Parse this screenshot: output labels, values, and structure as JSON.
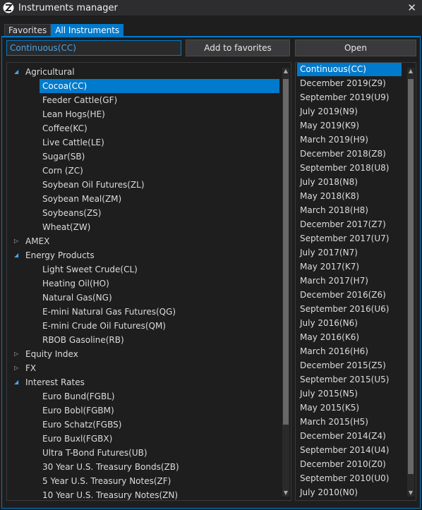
{
  "window": {
    "title": "Instruments manager",
    "close_label": "✕"
  },
  "tabs": [
    {
      "label": "Favorites",
      "active": false
    },
    {
      "label": "All Instruments",
      "active": true
    }
  ],
  "search": {
    "value": "Continuous(CC)"
  },
  "buttons": {
    "add_favorites": "Add to favorites",
    "open": "Open"
  },
  "tree": [
    {
      "type": "group",
      "label": "Agricultural",
      "expanded": true
    },
    {
      "type": "item",
      "label": "Cocoa(CC)",
      "selected": true
    },
    {
      "type": "item",
      "label": "Feeder Cattle(GF)"
    },
    {
      "type": "item",
      "label": "Lean Hogs(HE)"
    },
    {
      "type": "item",
      "label": "Coffee(KC)"
    },
    {
      "type": "item",
      "label": "Live Cattle(LE)"
    },
    {
      "type": "item",
      "label": "Sugar(SB)"
    },
    {
      "type": "item",
      "label": "Corn (ZC)"
    },
    {
      "type": "item",
      "label": "Soybean Oil Futures(ZL)"
    },
    {
      "type": "item",
      "label": "Soybean Meal(ZM)"
    },
    {
      "type": "item",
      "label": "Soybeans(ZS)"
    },
    {
      "type": "item",
      "label": "Wheat(ZW)"
    },
    {
      "type": "group",
      "label": "AMEX",
      "expanded": false
    },
    {
      "type": "group",
      "label": "Energy Products",
      "expanded": true
    },
    {
      "type": "item",
      "label": "Light Sweet Crude(CL)"
    },
    {
      "type": "item",
      "label": "Heating Oil(HO)"
    },
    {
      "type": "item",
      "label": "Natural Gas(NG)"
    },
    {
      "type": "item",
      "label": "E-mini Natural Gas Futures(QG)"
    },
    {
      "type": "item",
      "label": "E-mini Crude Oil Futures(QM)"
    },
    {
      "type": "item",
      "label": "RBOB Gasoline(RB)"
    },
    {
      "type": "group",
      "label": "Equity Index",
      "expanded": false
    },
    {
      "type": "group",
      "label": "FX",
      "expanded": false
    },
    {
      "type": "group",
      "label": "Interest Rates",
      "expanded": true
    },
    {
      "type": "item",
      "label": "Euro Bund(FGBL)"
    },
    {
      "type": "item",
      "label": "Euro Bobl(FGBM)"
    },
    {
      "type": "item",
      "label": "Euro Schatz(FGBS)"
    },
    {
      "type": "item",
      "label": "Euro Buxl(FGBX)"
    },
    {
      "type": "item",
      "label": "Ultra T-Bond Futures(UB)"
    },
    {
      "type": "item",
      "label": "30 Year U.S. Treasury Bonds(ZB)"
    },
    {
      "type": "item",
      "label": "5 Year U.S. Treasury Notes(ZF)"
    },
    {
      "type": "item",
      "label": "10 Year U.S. Treasury Notes(ZN)"
    }
  ],
  "contracts": [
    {
      "label": "Continuous(CC)",
      "selected": true
    },
    {
      "label": "December 2019(Z9)"
    },
    {
      "label": "September 2019(U9)"
    },
    {
      "label": "July 2019(N9)"
    },
    {
      "label": "May 2019(K9)"
    },
    {
      "label": "March 2019(H9)"
    },
    {
      "label": "December 2018(Z8)"
    },
    {
      "label": "September 2018(U8)"
    },
    {
      "label": "July 2018(N8)"
    },
    {
      "label": "May 2018(K8)"
    },
    {
      "label": "March 2018(H8)"
    },
    {
      "label": "December 2017(Z7)"
    },
    {
      "label": "September 2017(U7)"
    },
    {
      "label": "July 2017(N7)"
    },
    {
      "label": "May 2017(K7)"
    },
    {
      "label": "March 2017(H7)"
    },
    {
      "label": "December 2016(Z6)"
    },
    {
      "label": "September 2016(U6)"
    },
    {
      "label": "July 2016(N6)"
    },
    {
      "label": "May 2016(K6)"
    },
    {
      "label": "March 2016(H6)"
    },
    {
      "label": "December 2015(Z5)"
    },
    {
      "label": "September 2015(U5)"
    },
    {
      "label": "July 2015(N5)"
    },
    {
      "label": "May 2015(K5)"
    },
    {
      "label": "March 2015(H5)"
    },
    {
      "label": "December 2014(Z4)"
    },
    {
      "label": "September 2014(U4)"
    },
    {
      "label": "December 2010(Z0)"
    },
    {
      "label": "September 2010(U0)"
    },
    {
      "label": "July 2010(N0)"
    }
  ],
  "colors": {
    "accent": "#007acc",
    "background": "#1e1e1e",
    "text": "#dcdcdc"
  }
}
